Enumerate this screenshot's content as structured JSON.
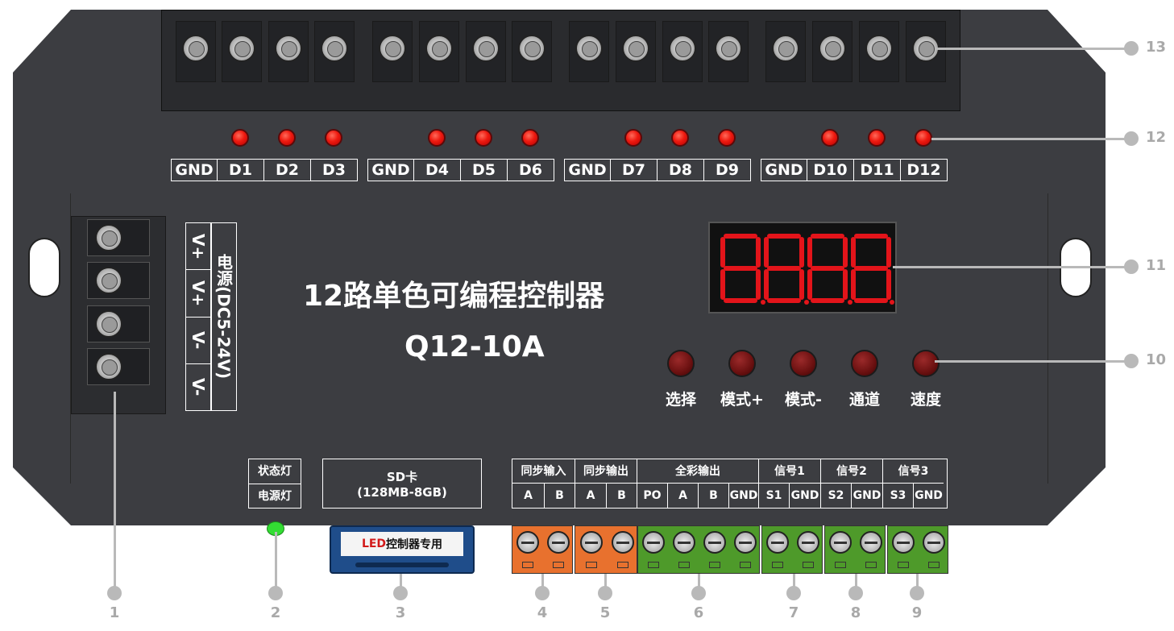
{
  "title": "12路单色可编程控制器",
  "model": "Q12-10A",
  "top_channel_groups": [
    [
      "GND",
      "D1",
      "D2",
      "D3"
    ],
    [
      "GND",
      "D4",
      "D5",
      "D6"
    ],
    [
      "GND",
      "D7",
      "D8",
      "D9"
    ],
    [
      "GND",
      "D10",
      "D11",
      "D12"
    ]
  ],
  "power": {
    "terminals": [
      "V+",
      "V+",
      "V-",
      "V-"
    ],
    "label": "电源(DC5-24V)"
  },
  "buttons": [
    "选择",
    "模式+",
    "模式-",
    "通道",
    "速度"
  ],
  "indicator_labels": [
    "状态灯",
    "电源灯"
  ],
  "sd_card": {
    "label": "SD卡",
    "capacity": "(128MB-8GB)",
    "sticker": "控制器专用",
    "sticker_prefix": "LED"
  },
  "bottom_table": {
    "groups": [
      {
        "name": "同步输入",
        "pins": [
          "A",
          "B"
        ]
      },
      {
        "name": "同步输出",
        "pins": [
          "A",
          "B"
        ]
      },
      {
        "name": "全彩输出",
        "pins": [
          "PO",
          "A",
          "B",
          "GND"
        ]
      },
      {
        "name": "信号1",
        "pins": [
          "S1",
          "GND"
        ]
      },
      {
        "name": "信号2",
        "pins": [
          "S2",
          "GND"
        ]
      },
      {
        "name": "信号3",
        "pins": [
          "S3",
          "GND"
        ]
      }
    ]
  },
  "callouts_right": [
    "13",
    "12",
    "11",
    "10"
  ],
  "callouts_bottom": [
    "1",
    "2",
    "3",
    "4",
    "5",
    "6",
    "7",
    "8",
    "9"
  ],
  "colors": {
    "panel": "#3c3d41",
    "led_red": "#ee1a10",
    "terminal_orange": "#e8712e",
    "terminal_green": "#4e9a2a",
    "status_led": "#33dd33",
    "sd_blue": "#1f4d8a"
  }
}
